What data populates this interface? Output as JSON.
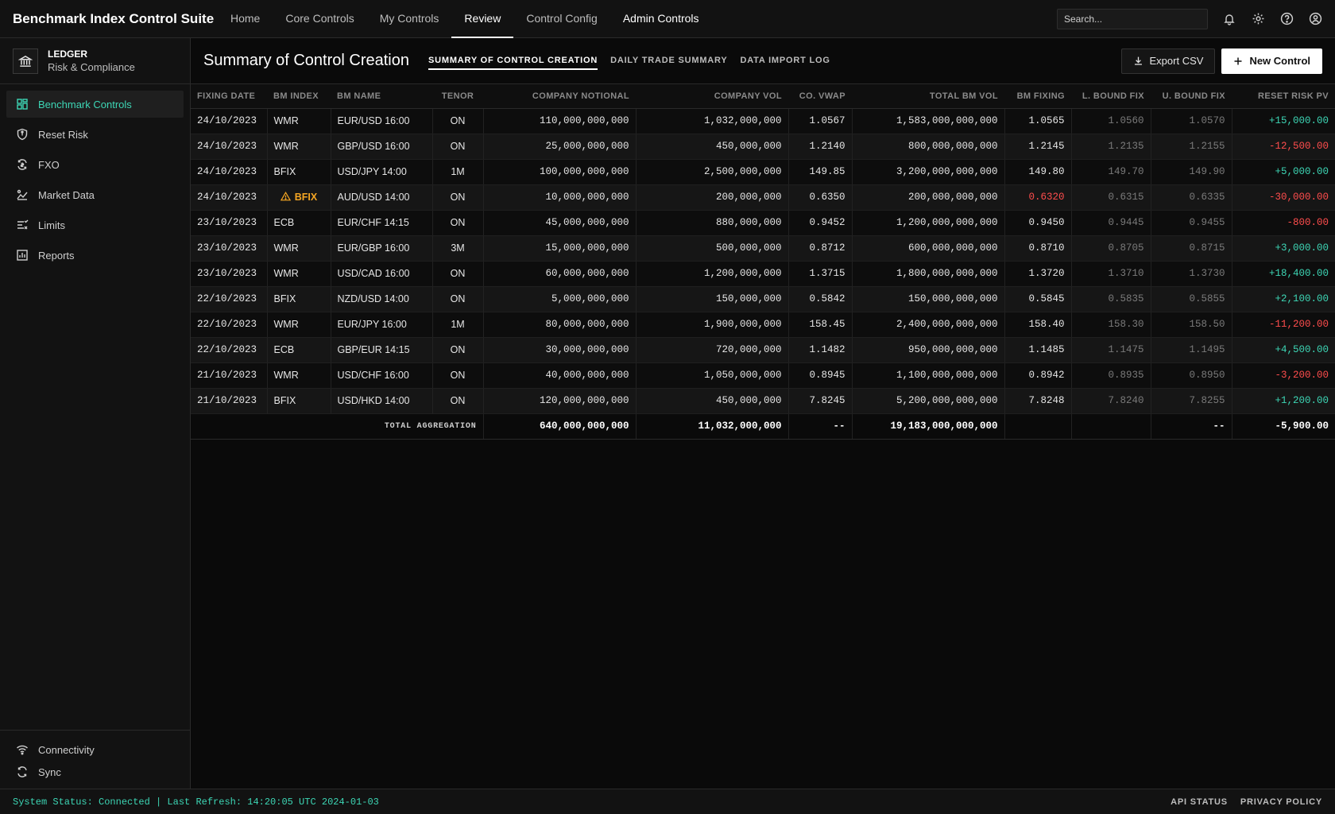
{
  "app": {
    "title": "Benchmark Index Control Suite"
  },
  "topnav": {
    "items": [
      {
        "label": "Home"
      },
      {
        "label": "Core Controls"
      },
      {
        "label": "My Controls"
      },
      {
        "label": "Review"
      },
      {
        "label": "Control Config"
      },
      {
        "label": "Admin Controls"
      }
    ],
    "active": "Review",
    "search_placeholder": "Search..."
  },
  "sidebar": {
    "org_name": "LEDGER",
    "org_subtitle": "Risk & Compliance",
    "items": [
      {
        "label": "Benchmark Controls",
        "icon": "grid-icon",
        "active": true
      },
      {
        "label": "Reset Risk",
        "icon": "shield-icon"
      },
      {
        "label": "FXO",
        "icon": "exchange-icon"
      },
      {
        "label": "Market Data",
        "icon": "chart-line-icon"
      },
      {
        "label": "Limits",
        "icon": "limits-icon"
      },
      {
        "label": "Reports",
        "icon": "report-icon"
      }
    ],
    "footer": [
      {
        "label": "Connectivity",
        "icon": "wifi-icon"
      },
      {
        "label": "Sync",
        "icon": "sync-icon"
      }
    ]
  },
  "page": {
    "title": "Summary of Control Creation",
    "tabs": [
      {
        "label": "SUMMARY OF CONTROL CREATION",
        "active": true
      },
      {
        "label": "DAILY TRADE SUMMARY"
      },
      {
        "label": "DATA IMPORT LOG"
      }
    ],
    "export_label": "Export CSV",
    "new_label": "New Control"
  },
  "table": {
    "headers": [
      "FIXING DATE",
      "BM INDEX",
      "BM NAME",
      "TENOR",
      "COMPANY NOTIONAL",
      "COMPANY VOL",
      "CO. VWAP",
      "TOTAL BM VOL",
      "BM FIXING",
      "L. BOUND FIX",
      "U. BOUND FIX",
      "RESET RISK PV"
    ],
    "rows": [
      [
        "24/10/2023",
        "WMR",
        "EUR/USD 16:00",
        "ON",
        "110,000,000,000",
        "1,032,000,000",
        "1.0567",
        "1,583,000,000,000",
        "1.0565",
        "1.0560",
        "1.0570",
        "+15,000.00"
      ],
      [
        "24/10/2023",
        "WMR",
        "GBP/USD 16:00",
        "ON",
        "25,000,000,000",
        "450,000,000",
        "1.2140",
        "800,000,000,000",
        "1.2145",
        "1.2135",
        "1.2155",
        "-12,500.00"
      ],
      [
        "24/10/2023",
        "BFIX",
        "USD/JPY 14:00",
        "1M",
        "100,000,000,000",
        "2,500,000,000",
        "149.85",
        "3,200,000,000,000",
        "149.80",
        "149.70",
        "149.90",
        "+5,000.00"
      ],
      [
        "24/10/2023",
        "BFIX",
        "AUD/USD 14:00",
        "ON",
        "10,000,000,000",
        "200,000,000",
        "0.6350",
        "200,000,000,000",
        "0.6320",
        "0.6315",
        "0.6335",
        "-30,000.00"
      ],
      [
        "23/10/2023",
        "ECB",
        "EUR/CHF 14:15",
        "ON",
        "45,000,000,000",
        "880,000,000",
        "0.9452",
        "1,200,000,000,000",
        "0.9450",
        "0.9445",
        "0.9455",
        "-800.00"
      ],
      [
        "23/10/2023",
        "WMR",
        "EUR/GBP 16:00",
        "3M",
        "15,000,000,000",
        "500,000,000",
        "0.8712",
        "600,000,000,000",
        "0.8710",
        "0.8705",
        "0.8715",
        "+3,000.00"
      ],
      [
        "23/10/2023",
        "WMR",
        "USD/CAD 16:00",
        "ON",
        "60,000,000,000",
        "1,200,000,000",
        "1.3715",
        "1,800,000,000,000",
        "1.3720",
        "1.3710",
        "1.3730",
        "+18,400.00"
      ],
      [
        "22/10/2023",
        "BFIX",
        "NZD/USD 14:00",
        "ON",
        "5,000,000,000",
        "150,000,000",
        "0.5842",
        "150,000,000,000",
        "0.5845",
        "0.5835",
        "0.5855",
        "+2,100.00"
      ],
      [
        "22/10/2023",
        "WMR",
        "EUR/JPY 16:00",
        "1M",
        "80,000,000,000",
        "1,900,000,000",
        "158.45",
        "2,400,000,000,000",
        "158.40",
        "158.30",
        "158.50",
        "-11,200.00"
      ],
      [
        "22/10/2023",
        "ECB",
        "GBP/EUR 14:15",
        "ON",
        "30,000,000,000",
        "720,000,000",
        "1.1482",
        "950,000,000,000",
        "1.1485",
        "1.1475",
        "1.1495",
        "+4,500.00"
      ],
      [
        "21/10/2023",
        "WMR",
        "USD/CHF 16:00",
        "ON",
        "40,000,000,000",
        "1,050,000,000",
        "0.8945",
        "1,100,000,000,000",
        "0.8942",
        "0.8935",
        "0.8950",
        "-3,200.00"
      ],
      [
        "21/10/2023",
        "BFIX",
        "USD/HKD 14:00",
        "ON",
        "120,000,000,000",
        "450,000,000",
        "7.8245",
        "5,200,000,000,000",
        "7.8248",
        "7.8240",
        "7.8255",
        "+1,200.00"
      ]
    ],
    "warning_row": 3,
    "breach_row": 3,
    "total": {
      "label": "TOTAL AGGREGATION",
      "company_notional": "640,000,000,000",
      "company_vol": "11,032,000,000",
      "vwap": "--",
      "total_bm_vol": "19,183,000,000,000",
      "u_bound": "--",
      "reset_risk_pv": "-5,900.00"
    }
  },
  "statusbar": {
    "text": "System Status: Connected | Last Refresh: 14:20:05 UTC 2024-01-03",
    "links": [
      "API STATUS",
      "PRIVACY POLICY"
    ]
  },
  "colors": {
    "accent": "#3dd6b5",
    "negative": "#ff4d4d",
    "warning": "#f5a623"
  }
}
